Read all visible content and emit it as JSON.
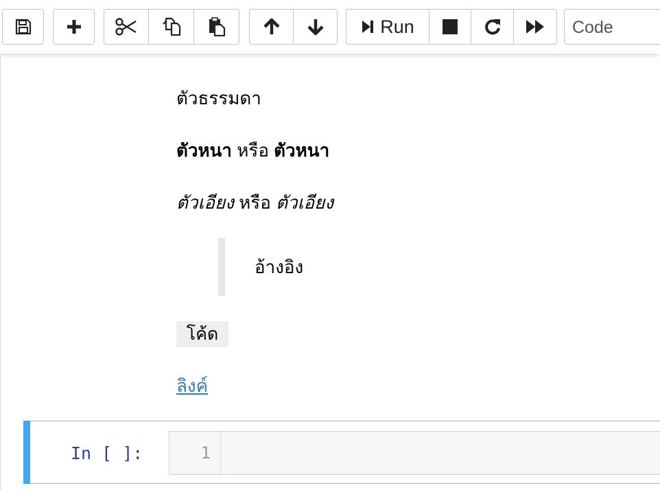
{
  "toolbar": {
    "buttons": {
      "save": "save-icon",
      "insert_cell": "plus-icon",
      "cut": "scissors-icon",
      "copy": "copy-icon",
      "paste": "paste-icon",
      "move_up": "arrow-up-icon",
      "move_down": "arrow-down-icon",
      "interrupt": "stop-icon",
      "restart": "restart-icon",
      "run_all": "fast-forward-icon"
    },
    "run_label": "Run",
    "cell_type": "Code"
  },
  "markdown": {
    "normal": "ตัวธรรมดา",
    "bold_1": "ตัวหนา",
    "or_1": " หรือ ",
    "bold_2": "ตัวหนา",
    "italic_1": "ตัวเอียง",
    "or_2": " หรือ ",
    "italic_2": "ตัวเอียง",
    "quote": "อ้างอิง",
    "code": "โค้ด",
    "link": "ลิงค์"
  },
  "code_cell": {
    "prompt": "In [ ]:",
    "line_number": "1",
    "source": ""
  },
  "colors": {
    "selected_cell_accent": "#42a5f5",
    "prompt": "#303f9f",
    "link": "#337ab7"
  }
}
